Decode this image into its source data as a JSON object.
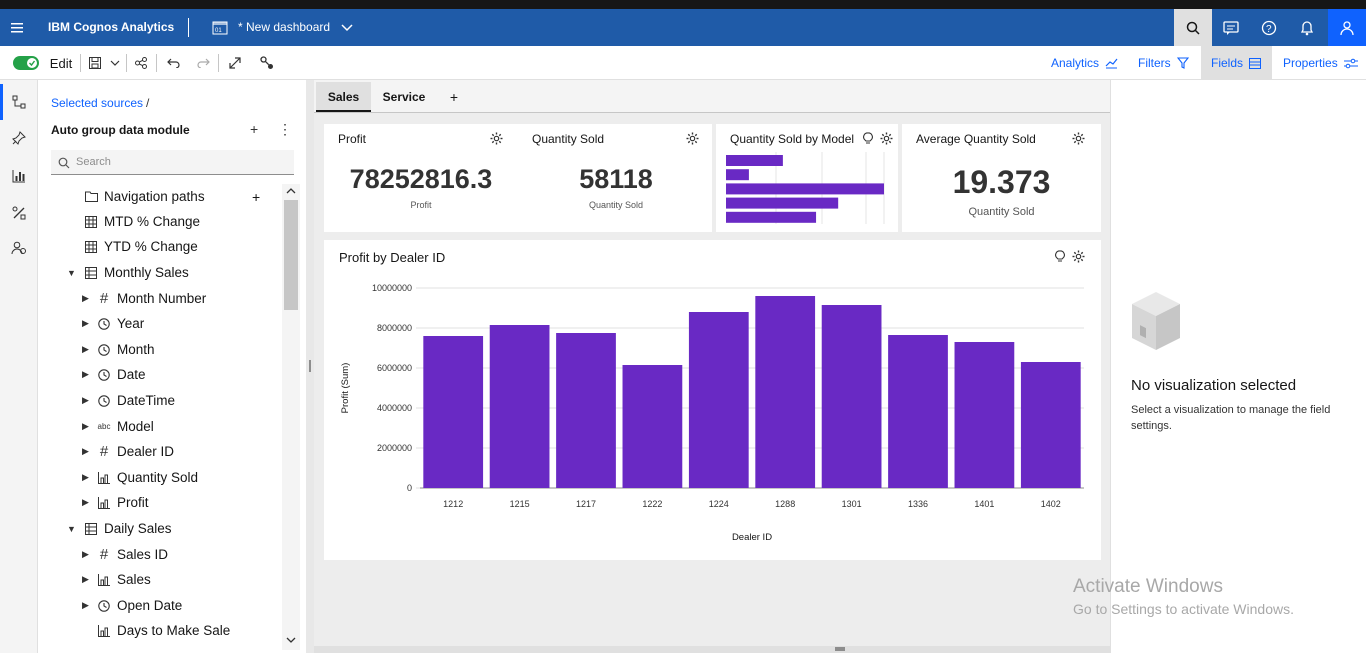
{
  "app": {
    "product_name": "IBM Cognos Analytics",
    "document_title": "* New dashboard"
  },
  "toolbar": {
    "edit_label": "Edit",
    "right_links": [
      "Analytics",
      "Filters",
      "Fields",
      "Properties"
    ]
  },
  "sources": {
    "breadcrumb_link": "Selected sources",
    "breadcrumb_sep": "/",
    "module_name": "Auto group data module",
    "search_placeholder": "Search",
    "tree": [
      {
        "label": "Navigation paths",
        "icon": "folder-icon",
        "level": 0,
        "caret": "",
        "add": "+"
      },
      {
        "label": "MTD % Change",
        "icon": "calculation-icon",
        "level": 0,
        "caret": ""
      },
      {
        "label": "YTD % Change",
        "icon": "calculation-icon",
        "level": 0,
        "caret": ""
      },
      {
        "label": "Monthly Sales",
        "icon": "table-icon",
        "level": 0,
        "caret": "▼"
      },
      {
        "label": "Month Number",
        "icon": "hash-icon",
        "level": 1,
        "caret": "▶"
      },
      {
        "label": "Year",
        "icon": "clock-icon",
        "level": 1,
        "caret": "▶"
      },
      {
        "label": "Month",
        "icon": "clock-icon",
        "level": 1,
        "caret": "▶"
      },
      {
        "label": "Date",
        "icon": "clock-icon",
        "level": 1,
        "caret": "▶"
      },
      {
        "label": "DateTime",
        "icon": "clock-icon",
        "level": 1,
        "caret": "▶"
      },
      {
        "label": "Model",
        "icon": "text-icon",
        "level": 1,
        "caret": "▶"
      },
      {
        "label": "Dealer ID",
        "icon": "hash-icon",
        "level": 1,
        "caret": "▶"
      },
      {
        "label": "Quantity Sold",
        "icon": "measure-icon",
        "level": 1,
        "caret": "▶"
      },
      {
        "label": "Profit",
        "icon": "measure-icon",
        "level": 1,
        "caret": "▶"
      },
      {
        "label": "Daily Sales",
        "icon": "table-icon",
        "level": 0,
        "caret": "▼"
      },
      {
        "label": "Sales ID",
        "icon": "hash-icon",
        "level": 1,
        "caret": "▶"
      },
      {
        "label": "Sales",
        "icon": "measure-icon",
        "level": 1,
        "caret": "▶"
      },
      {
        "label": "Open Date",
        "icon": "clock-icon",
        "level": 1,
        "caret": "▶"
      },
      {
        "label": "Days to Make Sale",
        "icon": "measure-icon",
        "level": 1,
        "caret": ""
      }
    ]
  },
  "tabs": {
    "items": [
      "Sales",
      "Service"
    ],
    "add_label": "+"
  },
  "widgets": {
    "profit": {
      "title": "Profit",
      "value": "78252816.3",
      "caption": "Profit"
    },
    "quantity": {
      "title": "Quantity Sold",
      "value": "58118",
      "caption": "Quantity Sold"
    },
    "by_model": {
      "title": "Quantity Sold by Model"
    },
    "average": {
      "title": "Average Quantity Sold",
      "value": "19.373",
      "caption": "Quantity Sold"
    }
  },
  "chart_data": [
    {
      "type": "bar",
      "orientation": "horizontal",
      "title": "Quantity Sold by Model",
      "values": [
        3600,
        1450,
        10000,
        7100,
        5700
      ],
      "color": "#6929c4"
    },
    {
      "type": "bar",
      "title": "Profit by Dealer ID",
      "xlabel": "Dealer ID",
      "ylabel": "Profit (Sum)",
      "categories": [
        "1212",
        "1215",
        "1217",
        "1222",
        "1224",
        "1288",
        "1301",
        "1336",
        "1401",
        "1402"
      ],
      "values": [
        7600000,
        8150000,
        7750000,
        6150000,
        8800000,
        9600000,
        9150000,
        7650000,
        7300000,
        6300000
      ],
      "ylim": [
        0,
        10000000
      ],
      "yticks": [
        "0",
        "2000000",
        "4000000",
        "6000000",
        "8000000",
        "10000000"
      ],
      "grid": true,
      "color": "#6929c4"
    }
  ],
  "properties": {
    "empty_title": "No visualization selected",
    "empty_desc": "Select a visualization to manage the field settings."
  },
  "watermark": {
    "title": "Activate Windows",
    "subtitle": "Go to Settings to activate Windows."
  }
}
